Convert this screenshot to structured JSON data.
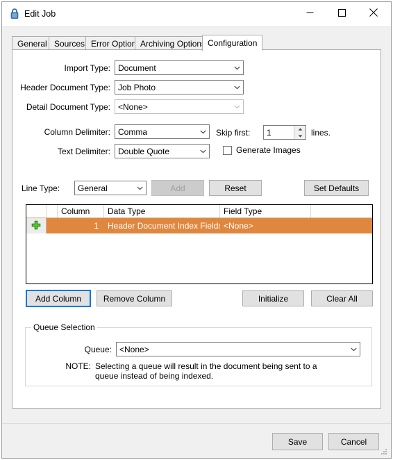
{
  "window": {
    "title": "Edit Job",
    "icon": "lock-icon",
    "controls": {
      "minimize": "minimize-icon",
      "maximize": "maximize-icon",
      "close": "close-icon"
    }
  },
  "tabs": [
    {
      "label": "General",
      "active": false
    },
    {
      "label": "Sources",
      "active": false
    },
    {
      "label": "Error Options",
      "active": false
    },
    {
      "label": "Archiving Options",
      "active": false
    },
    {
      "label": "Configuration",
      "active": true
    }
  ],
  "configuration": {
    "import_type": {
      "label": "Import Type:",
      "value": "Document",
      "enabled": true
    },
    "header_document_type": {
      "label": "Header Document Type:",
      "value": "Job Photo",
      "enabled": true
    },
    "detail_document_type": {
      "label": "Detail Document Type:",
      "value": "<None>",
      "enabled": false
    },
    "column_delimiter": {
      "label": "Column Delimiter:",
      "value": "Comma",
      "enabled": true
    },
    "text_delimiter": {
      "label": "Text Delimiter:",
      "value": "Double Quote",
      "enabled": true
    },
    "skip_first": {
      "label": "Skip first:",
      "value": "1",
      "suffix": "lines."
    },
    "generate_images": {
      "label": "Generate Images",
      "checked": false
    },
    "line_type": {
      "label": "Line Type:",
      "value": "General",
      "enabled": true
    },
    "buttons": {
      "add": {
        "label": "Add",
        "enabled": false
      },
      "reset": {
        "label": "Reset",
        "enabled": true
      },
      "set_defaults": {
        "label": "Set Defaults",
        "enabled": true
      },
      "add_column": {
        "label": "Add Column",
        "enabled": true,
        "focused": true
      },
      "remove_column": {
        "label": "Remove Column",
        "enabled": true
      },
      "initialize": {
        "label": "Initialize",
        "enabled": true
      },
      "clear_all": {
        "label": "Clear All",
        "enabled": true
      }
    },
    "grid": {
      "columns": [
        "",
        "",
        "Column",
        "Data Type",
        "Field Type",
        ""
      ],
      "rows": [
        {
          "indicator": "plus-icon",
          "column": "1",
          "data_type": "Header Document Index Fields",
          "field_type": "<None>",
          "selected": true
        }
      ]
    },
    "queue_selection": {
      "title": "Queue Selection",
      "queue_label": "Queue:",
      "queue_value": "<None>",
      "note_label": "NOTE:",
      "note_line1": "Selecting a queue will result in the document being sent to a",
      "note_line2": "queue instead of being indexed."
    }
  },
  "footer": {
    "save": "Save",
    "cancel": "Cancel"
  },
  "colors": {
    "selected_row": "#e0873f",
    "focus_border": "#0078d7",
    "dialog_bg": "#f0f0f0",
    "panel_bg": "#ffffff"
  }
}
